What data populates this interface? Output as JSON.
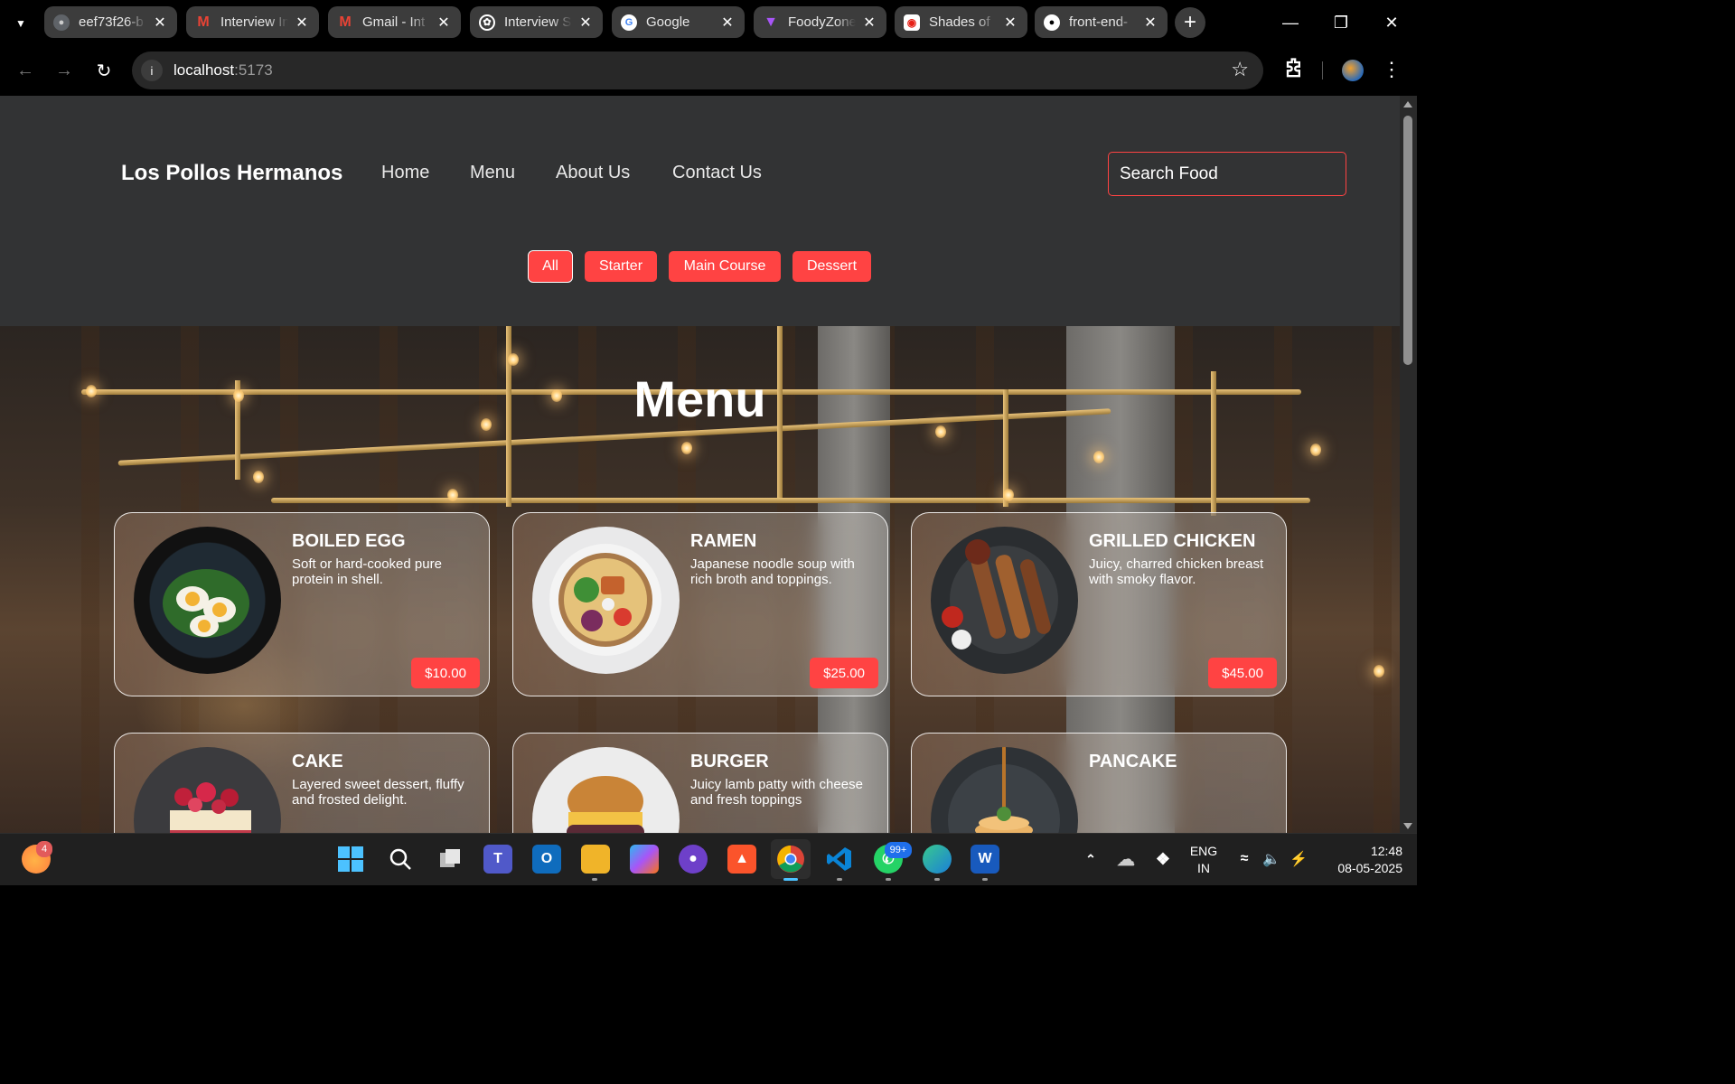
{
  "browser": {
    "tabs": [
      {
        "title": "eef73f26-b",
        "icon": "globe-icon",
        "color": "#9aa0a6"
      },
      {
        "title": "Interview In",
        "icon": "gmail-icon",
        "color": "#ea4335"
      },
      {
        "title": "Gmail - Int",
        "icon": "gmail-icon",
        "color": "#ea4335"
      },
      {
        "title": "Interview S",
        "icon": "openai-icon",
        "color": "#ffffff"
      },
      {
        "title": "Google",
        "icon": "google-icon",
        "color": "#ffffff"
      },
      {
        "title": "FoodyZone",
        "icon": "vite-icon",
        "color": "#a855f7"
      },
      {
        "title": "Shades of",
        "icon": "youtube-icon",
        "color": "#ff0000"
      },
      {
        "title": "front-end-",
        "icon": "github-icon",
        "color": "#ffffff"
      }
    ],
    "url_host": "localhost",
    "url_port": ":5173"
  },
  "site": {
    "brand": "Los Pollos Hermanos",
    "nav": [
      "Home",
      "Menu",
      "About Us",
      "Contact Us"
    ],
    "search_placeholder": "Search Food",
    "filters": [
      "All",
      "Starter",
      "Main Course",
      "Dessert"
    ],
    "active_filter": "All",
    "hero_title": "Menu",
    "accent": "#ff4343",
    "items": [
      {
        "name": "BOILED EGG",
        "desc": "Soft or hard-cooked pure protein in shell.",
        "price": "$10.00"
      },
      {
        "name": "RAMEN",
        "desc": "Japanese noodle soup with rich broth and toppings.",
        "price": "$25.00"
      },
      {
        "name": "GRILLED CHICKEN",
        "desc": "Juicy, charred chicken breast with smoky flavor.",
        "price": "$45.00"
      },
      {
        "name": "CAKE",
        "desc": "Layered sweet dessert, fluffy and frosted delight.",
        "price": ""
      },
      {
        "name": "BURGER",
        "desc": "Juicy lamb patty with cheese and fresh toppings",
        "price": ""
      },
      {
        "name": "PANCAKE",
        "desc": "",
        "price": ""
      }
    ]
  },
  "taskbar": {
    "weather_badge": "4",
    "whatsapp_badge": "99+",
    "lang_line1": "ENG",
    "lang_line2": "IN",
    "time": "12:48",
    "date": "08-05-2025"
  }
}
